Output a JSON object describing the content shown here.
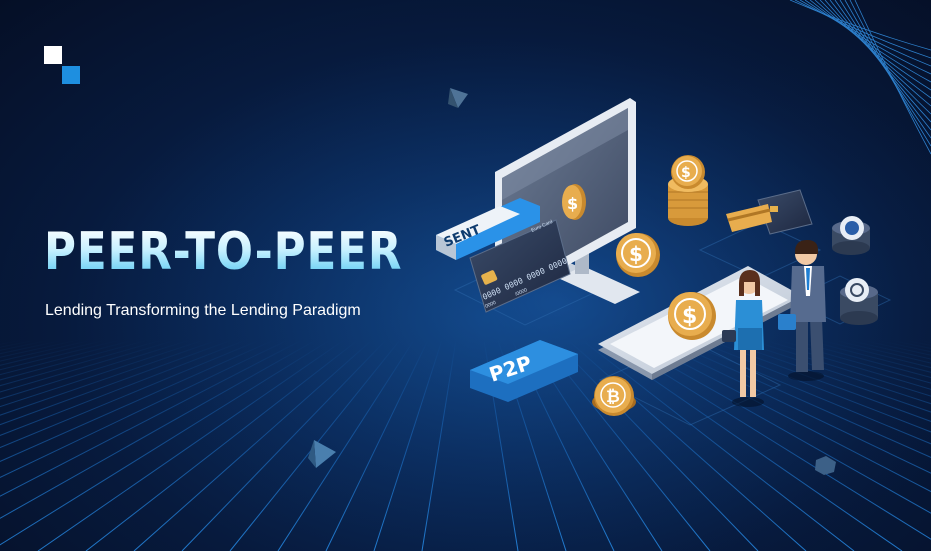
{
  "brand": {
    "logo_icon": "two-squares-logo-icon",
    "accent_white": "#ffffff",
    "accent_blue": "#1e8fe0"
  },
  "hero": {
    "headline": "PEER-TO-PEER",
    "subline": "Lending Transforming the Lending Paradigm"
  },
  "illustration": {
    "sent_tag": "SENT",
    "card_brand": "Euro Card",
    "card_number": "0000 0000 0000 0000",
    "card_small": "0000",
    "card_expiry": "/0000",
    "p2p_label": "P2P",
    "coin_symbol": "$",
    "bitcoin_symbol": "₿",
    "icons": [
      "monitor-icon",
      "credit-card-icon",
      "dollar-coin-icon",
      "bitcoin-coin-icon",
      "smartphone-icon",
      "businessman-icon",
      "businesswoman-icon",
      "coin-stack-icon"
    ]
  },
  "colors": {
    "background": "#071a3d",
    "grid": "#1f7fe0",
    "headline_top": "#ffffff",
    "headline_bottom": "#57c8f2",
    "coin": "#e3a543",
    "p2p_button": "#2d8fe0"
  }
}
